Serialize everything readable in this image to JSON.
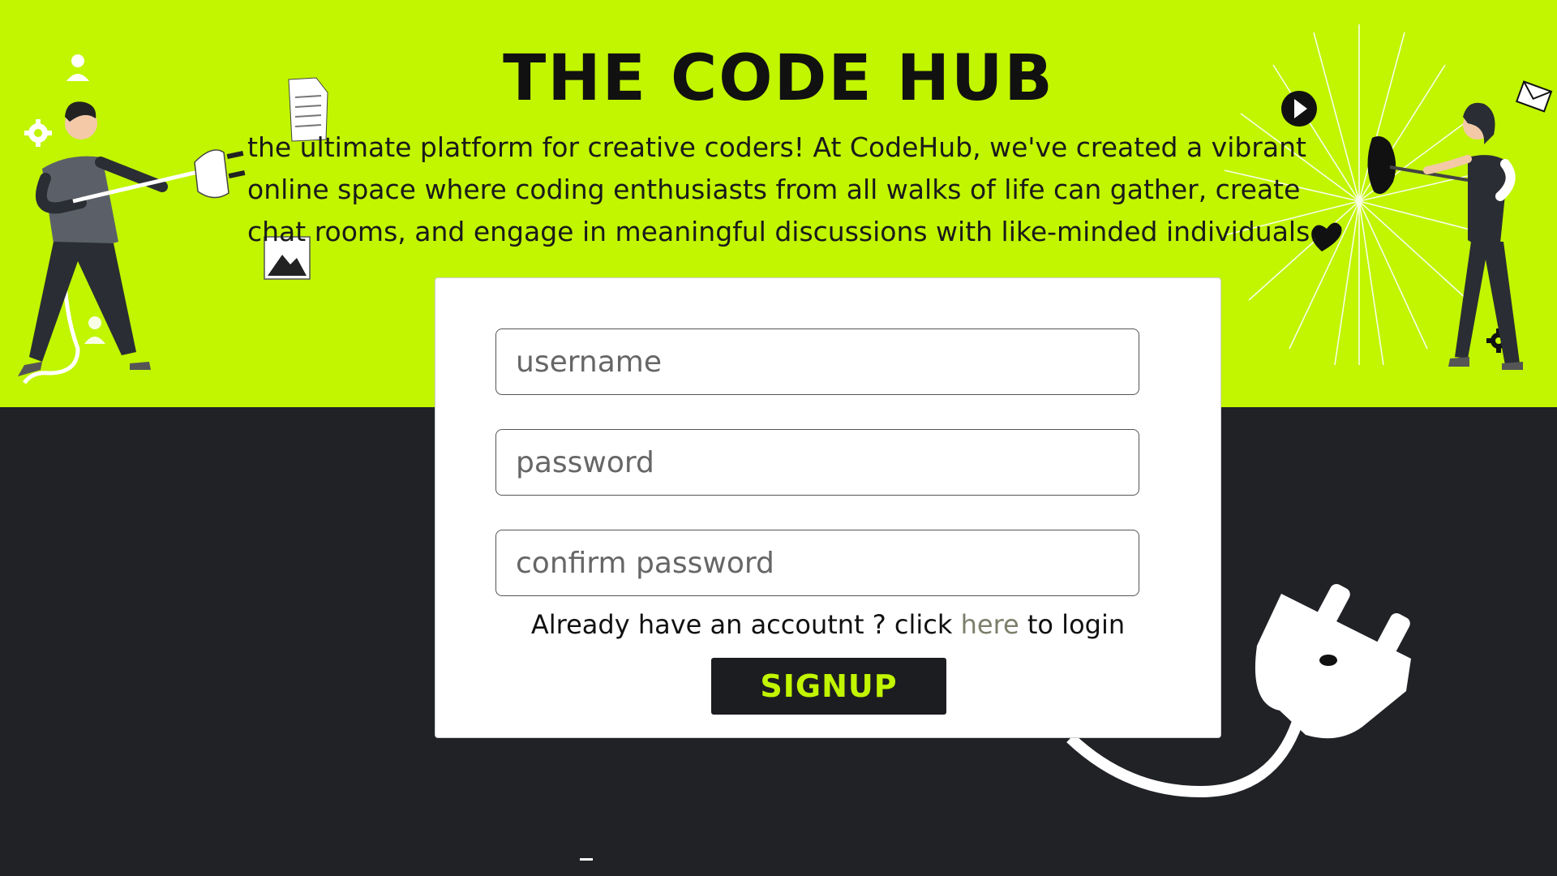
{
  "header": {
    "title": "THE CODE HUB",
    "description": "the ultimate platform for creative coders! At CodeHub, we've created a vibrant online space where coding enthusiasts from all walks of life can gather, create chat rooms, and engage in meaningful discussions with like-minded individuals."
  },
  "form": {
    "username_placeholder": "username",
    "password_placeholder": "password",
    "confirm_placeholder": "confirm password",
    "login_prefix": "Already have an accoutnt ? click ",
    "login_link": "here",
    "login_suffix": " to login",
    "signup_label": "SIGNUP"
  },
  "colors": {
    "accent": "#c1f500",
    "dark": "#202226",
    "card": "#ffffff"
  },
  "icons": [
    "user-icon",
    "gear-icon",
    "document-icon",
    "image-icon",
    "play-icon",
    "envelope-icon",
    "heart-icon",
    "plug-icon"
  ]
}
